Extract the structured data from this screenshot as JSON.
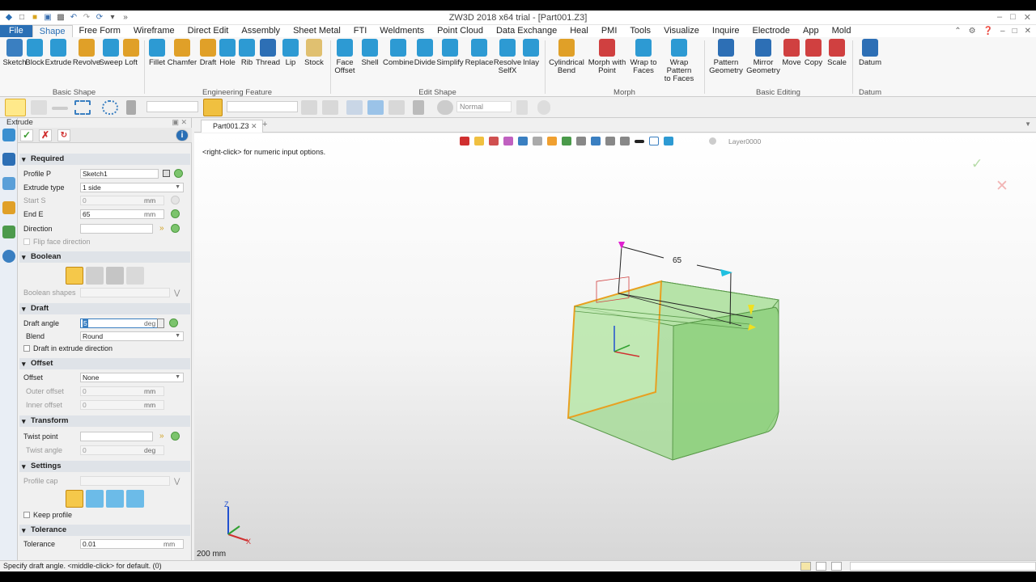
{
  "title": "ZW3D 2018 x64 trial - [Part001.Z3]",
  "menu": [
    "File",
    "Shape",
    "Free Form",
    "Wireframe",
    "Direct Edit",
    "Assembly",
    "Sheet Metal",
    "FTI",
    "Weldments",
    "Point Cloud",
    "Data Exchange",
    "Heal",
    "PMI",
    "Tools",
    "Visualize",
    "Inquire",
    "Electrode",
    "App",
    "Mold"
  ],
  "ribbon": {
    "tools": [
      {
        "l1": "Sketch",
        "l2": "",
        "c": "#3a7fc1"
      },
      {
        "l1": "Block",
        "l2": "",
        "c": "#2d9ad3"
      },
      {
        "l1": "Extrude",
        "l2": "",
        "c": "#2d9ad3"
      },
      {
        "l1": "Revolve",
        "l2": "",
        "c": "#e0a028"
      },
      {
        "l1": "Sweep",
        "l2": "",
        "c": "#2d9ad3"
      },
      {
        "l1": "Loft",
        "l2": "",
        "c": "#e0a028"
      },
      {
        "l1": "Fillet",
        "l2": "",
        "c": "#2d9ad3"
      },
      {
        "l1": "Chamfer",
        "l2": "",
        "c": "#e0a028"
      },
      {
        "l1": "Draft",
        "l2": "",
        "c": "#e0a028"
      },
      {
        "l1": "Hole",
        "l2": "",
        "c": "#2d9ad3"
      },
      {
        "l1": "Rib",
        "l2": "",
        "c": "#2d9ad3"
      },
      {
        "l1": "Thread",
        "l2": "",
        "c": "#2d6fb5"
      },
      {
        "l1": "Lip",
        "l2": "",
        "c": "#2d9ad3"
      },
      {
        "l1": "Stock",
        "l2": "",
        "c": "#e0c070"
      },
      {
        "l1": "Face",
        "l2": "Offset",
        "c": "#2d9ad3"
      },
      {
        "l1": "Shell",
        "l2": "",
        "c": "#2d9ad3"
      },
      {
        "l1": "Combine",
        "l2": "",
        "c": "#2d9ad3"
      },
      {
        "l1": "Divide",
        "l2": "",
        "c": "#2d9ad3"
      },
      {
        "l1": "Simplify",
        "l2": "",
        "c": "#2d9ad3"
      },
      {
        "l1": "Replace",
        "l2": "",
        "c": "#2d9ad3"
      },
      {
        "l1": "Resolve",
        "l2": "SelfX",
        "c": "#2d9ad3"
      },
      {
        "l1": "Inlay",
        "l2": "",
        "c": "#2d9ad3"
      },
      {
        "l1": "Cylindrical",
        "l2": "Bend",
        "c": "#e0a028"
      },
      {
        "l1": "Morph with",
        "l2": "Point",
        "c": "#d04040"
      },
      {
        "l1": "Wrap to",
        "l2": "Faces",
        "c": "#2d9ad3"
      },
      {
        "l1": "Wrap Pattern",
        "l2": "to Faces",
        "c": "#2d9ad3"
      },
      {
        "l1": "Pattern",
        "l2": "Geometry",
        "c": "#2d6fb5"
      },
      {
        "l1": "Mirror",
        "l2": "Geometry",
        "c": "#2d6fb5"
      },
      {
        "l1": "Move",
        "l2": "",
        "c": "#d04040"
      },
      {
        "l1": "Copy",
        "l2": "",
        "c": "#d04040"
      },
      {
        "l1": "Scale",
        "l2": "",
        "c": "#d04040"
      },
      {
        "l1": "Datum",
        "l2": "",
        "c": "#2d6fb5"
      }
    ],
    "groups": [
      "Basic Shape",
      "Engineering Feature",
      "Edit Shape",
      "Morph",
      "Basic Editing",
      "Datum"
    ]
  },
  "toolbar2": {
    "mode": "Normal"
  },
  "panel": {
    "title": "Extrude",
    "sections": {
      "required": "Required",
      "boolean": "Boolean",
      "draft": "Draft",
      "offset": "Offset",
      "transform": "Transform",
      "settings": "Settings",
      "tolerance": "Tolerance"
    },
    "profile_label": "Profile P",
    "profile_value": "Sketch1",
    "extrude_type_label": "Extrude type",
    "extrude_type_value": "1 side",
    "start_label": "Start S",
    "start_value": "0",
    "start_unit": "mm",
    "end_label": "End E",
    "end_value": "65",
    "end_unit": "mm",
    "direction_label": "Direction",
    "flip_label": "Flip face direction",
    "boolean_shapes_label": "Boolean shapes",
    "draft_angle_label": "Draft angle",
    "draft_angle_value": "5",
    "draft_angle_unit": "deg",
    "blend_label": "Blend",
    "blend_value": "Round",
    "draft_extrude_label": "Draft in extrude direction",
    "offset_label": "Offset",
    "offset_value": "None",
    "outer_offset_label": "Outer offset",
    "outer_offset_value": "0",
    "outer_unit": "mm",
    "inner_offset_label": "Inner offset",
    "inner_offset_value": "0",
    "inner_unit": "mm",
    "twist_point_label": "Twist point",
    "twist_angle_label": "Twist angle",
    "twist_angle_value": "0",
    "twist_unit": "deg",
    "profile_cap_label": "Profile cap",
    "keep_profile_label": "Keep profile",
    "tolerance_label": "Tolerance",
    "tolerance_value": "0.01",
    "tolerance_unit": "mm"
  },
  "doc_tab": "Part001.Z3",
  "viewport": {
    "hint": "<right-click> for numeric input options.",
    "dimension": "65",
    "scale": "200 mm",
    "layer": "Layer0000",
    "axis_x": "X",
    "axis_z": "Z"
  },
  "status": "Specify draft angle.  <middle-click> for default. (0)"
}
